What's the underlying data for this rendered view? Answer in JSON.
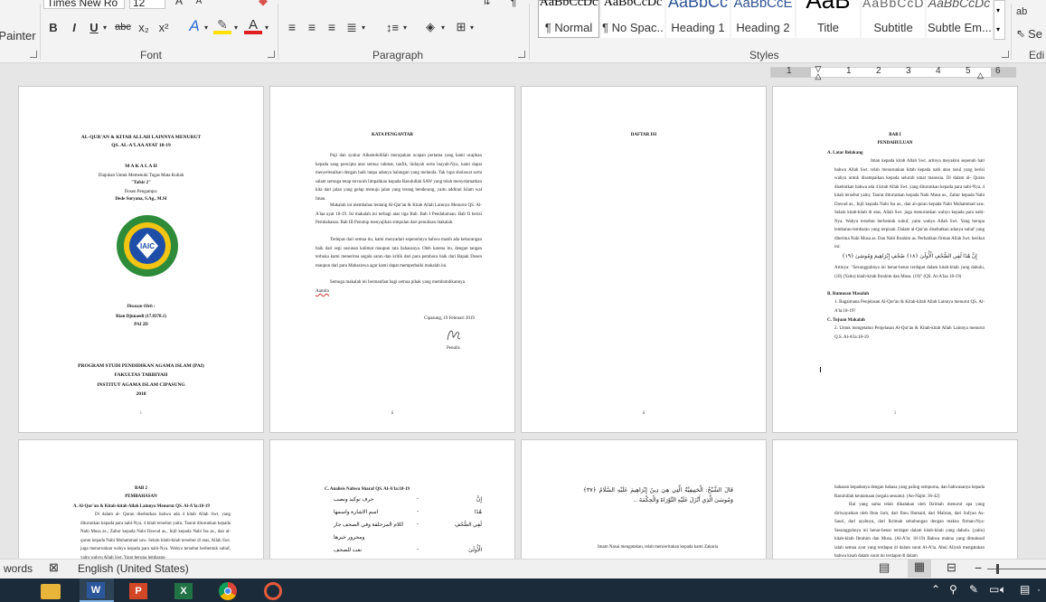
{
  "ribbon": {
    "clipboard": {
      "format_painter_label": "Painter"
    },
    "font": {
      "group_label": "Font",
      "font_name": "Times New Ro",
      "font_size": "12",
      "bold": "B",
      "italic": "I",
      "underline": "U",
      "strike": "abc",
      "subscript": "x₂",
      "superscript": "x²"
    },
    "paragraph": {
      "group_label": "Paragraph"
    },
    "styles": {
      "group_label": "Styles",
      "items": [
        {
          "preview": "AaBbCcDc",
          "name": "¶ Normal"
        },
        {
          "preview": "AaBbCcDc",
          "name": "¶ No Spac..."
        },
        {
          "preview": "AaBbCc",
          "name": "Heading 1"
        },
        {
          "preview": "AaBbCcE",
          "name": "Heading 2"
        },
        {
          "preview": "AaB",
          "name": "Title"
        },
        {
          "preview": "AaBbCcD",
          "name": "Subtitle"
        },
        {
          "preview": "AaBbCcDc",
          "name": "Subtle Em..."
        }
      ]
    },
    "editing": {
      "group_label": "Edi",
      "replace_label": "ac",
      "select_label": "Se"
    }
  },
  "ruler": {
    "numbers": [
      "1",
      "1",
      "2",
      "3",
      "4",
      "5",
      "6"
    ]
  },
  "pages": {
    "cover": {
      "title1": "AL-QUR'AN & KITAB ALLAH LAINNYA MENURUT",
      "title2": "QS. AL-A'LAA AYAT 18-19",
      "makalah": "M A K A L A H",
      "purpose": "Diajukan Untuk Memenuhi Tugas Mata Kuliah",
      "course": "\"Tafsir 2\"",
      "advisor_label": "Dosen Pengampu:",
      "advisor": "Dede Suryana, S.Ag., M.SI",
      "logo_text": "IAIC",
      "by_label": "Disusun Oleh :",
      "author": "Rian Djunaedi (17.0378.1)",
      "class": "PAI 2D",
      "prodi": "PROGRAM STUDI PENDIDIKAN AGAMA ISLAM (PAI)",
      "faculty": "FAKULTAS TARBIYAH",
      "institute": "INSTITUT AGAMA ISLAM CIPASUNG",
      "year": "2018",
      "page_number": "i"
    },
    "preface": {
      "heading": "KATA PENGANTAR",
      "p1": "Puji dan syukur Alhamdulillah merupakan ucapan pertama yang kami ucapkan kepada sang pencipta atas semua rahmat, taufik, hidayah serta inayah-Nya, kami dapat menyelesaikan dengan baik tanpa adanya halangan yang melanda. Tak lupa sholawat serta salam semoga tetap tercurah limpahkan kepada Rasulullah SAW yang telah menyelamatkan kita dari jalan yang gelap menuju jalan yang terang benderang, yaitu addinul Islam wal Iman.",
      "p2": "Makalah ini membahas tentang Al-Qur'an & Kitab Allah Lainnya Menurut QS. Al-A'laa ayat 18-19. Isi makalah ini terbagi atas tiga Bab. Bab I Pendahuluan. Bab II berisi Pembahasan. Bab III Penutup menyajikan simpulan dari penulisan makalah.",
      "p3": "Terlepas dari semua itu, kami menyadari sepenuhnya bahwa masih ada kekurangan baik dari segi susunan kalimat maupun tata bahasanya. Oleh karena itu, dengan tangan terbuka kami menerima segala saran dan kritik dari para pembaca baik dari Bapak Dosen maupun dari para Mahasiswa agar kami dapat memperbaiki makalah ini.",
      "p4": "Semoga makalah ini bermanfaat bagi semua pihak yang membutuhkannya.",
      "closing": "Aamiin",
      "place_date": "Cipasung, 19 Februari 2019",
      "signer": "Penulis",
      "page_number": "ii"
    },
    "toc": {
      "heading": "DAFTAR ISI",
      "page_number": "ii"
    },
    "bab1": {
      "heading1": "BAB I",
      "heading2": "PENDAHULUAN",
      "a_title": "A.  Latar Belakang",
      "a_text": "Iman kepada kitab Allah Swt. artinya meyakini sepenuh hati bahwa Allah Swt. telah menurunkan kitab kepada nabi atau rasul yang berisi wahyu untuk disampaikan kepada seluruh umat manusia. Di dalam al- Quran disebutkan bahwa ada 4 kitab Allah Swt. yang diturunkan kepada para nabi-Nya. 4 kitab tersebut yaitu; Taurat diturunkan kepada Nabi Musa as., Zabur kepada Nabi Dawud as., Injil kepada Nabi Isa as., dan al-quran kepada Nabi Muhammad saw. Selain kitab-kitab di atas, Allah Swt. juga menurunkan wahyu kepada para nabi-Nya. Wahyu tersebut berbentuk suhuf, yaitu wahyu Allah Swt. Yang berupa lembaran-lembaran yang terpisah. Dalam al-Qur'an disebutkan adanya suhuf yang diterima Nabi Musa as. Dan Nabi Ibrahim as. Perhatikan firman Allah Swt. berikut ini:",
      "arabic": "إِنَّ هَٰذَا لَفِي الصُّحُفِ الْأُولَىٰ ﴿١٨﴾ صُحُفِ إِبْرَاهِيمَ وَمُوسَىٰ ﴿١٩﴾",
      "translation": "Artinya: \"Sesungguhnya ini benar-benar terdapat dalam kitab-kitab yang dahulu, (18) (Yaitu) kitab-kitab Ibrahim dan Musa. (19)\" (QS. Al-A'laa 18-19)",
      "b_title": "B.  Rumusan Masalah",
      "b_text": "1.  Bagaimana Penjelasan Al-Qur'an & Kitab-kitab Allah Lainnya menurut QS. Al-A'la:18-19?",
      "c_title": "C.  Tujuan Makalah",
      "c_text": "2.  Untuk mengetahui Penjelasan Al-Qur'an & Kitab-kitab Allah Lainnya menurut Q.S. Al-A'la:18-19",
      "page_number": "1"
    },
    "bab2": {
      "heading1": "BAB 2",
      "heading2": "PEMBAHASAN",
      "a_title": "A.  Al-Qur'an & Kitab-kitab Allah Lainnya Menurut QS. Al-A'la:18-19",
      "a_text": "Di dalam al- Quran disebutkan bahwa ada 4 kitab Allah Swt. yang diturunkan kepada para nabi-Nya. 4 kitab tersebut yaitu; Taurat diturunkan kepada Nabi Musa as., Zabur kepada Nabi Dawud as., Injil kepada Nabi Isa as., dan al-quran kepada Nabi Muhammad saw. Selain kitab-kitab tersebut di atas, Allah Swt. juga menurunkan wahyu kepada para nabi-Nya. Wahyu tersebut berbentuk suhuf, yaitu wahyu Allah Swt. Yang berupa lembaran-"
    },
    "nahwu": {
      "title": "C.  Analisis Nahwu Sharaf QS. Al-A'la:18-19",
      "rows": [
        {
          "left": "حرف توكيد ونصب",
          "dash": "-",
          "right": "إِنَّ"
        },
        {
          "left": "اسم الاشارة واسمها",
          "dash": "-",
          "right": "هَٰذَا"
        },
        {
          "left": "اللام المزحلقة وفي الصحف جار",
          "dash": "-",
          "right": "لَفِي الصُّحُفِ"
        },
        {
          "left": "ومجرور خبرها",
          "dash": "",
          "right": ""
        },
        {
          "left": "نعت للصحف",
          "dash": "-",
          "right": "الْأُولَىٰ"
        }
      ]
    },
    "tafsir": {
      "arabic": "قَالَ الشَّيْخُ: الْحَنِيفِيَّةُ الَّتِي هِيَ دِينُ إِبْرَاهِيمَ عَلَيْهِ السَّلَامُ ﴿٣٧﴾ وَمُوسَىٰ الَّذِي أَنْزَلَ عَلَيْهِ التَّوْرَاةَ وَالْحِكْمَةَ ...",
      "text": "Imam Nasai mengatakan, telah menceritakan kepada kami Zakaria"
    },
    "last": {
      "text1": "bahasan kepadanya dengan bahasa yang paling sempurna, dan bahwasanya kepada Rasulullah keutamaan (segala sesuatu). (An-Najm: 36-42)",
      "text2": "Hal yang sama telah dikatakan oleh Ikrimah menurut apa yang diriwayatkan oleh Ibnu Jarir, dari Ibnu Humaid, dari Mahran, dari Sufyan As-Sauri, dari ayahnya, dari Ikrimah sehubungan dengan makna firman-Nya: Sesungguhnya ini benar-benar terdapat dalam kitab-kitab yang dahulu. (yaitu) kitab-kitab Ibrahim dan Musa. (Al-A'la: 18-19) Bahwa makna yang dimaksud ialah semua ayat yang terdapat di dalam surat Al-A'la. Abul Aliyah mengatakan bahwa kisah dalam surat ini terdapat di dalam"
    }
  },
  "status": {
    "words_label": "words",
    "language": "English (United States)"
  },
  "taskbar": {
    "apps": [
      "word-app",
      "powerpoint-app",
      "excel-app",
      "chrome-app",
      "other-app"
    ]
  },
  "colors": {
    "ribbon_bg": "#f3f3f3",
    "canvas_bg": "#e6e6e6",
    "taskbar_bg": "#1c2b3a",
    "word_blue": "#2b579a",
    "ppt_red": "#d24726",
    "excel_green": "#217346",
    "squiggle_red": "#d33333",
    "logo_green": "#2e8b3a",
    "logo_blue": "#1e4ea8",
    "logo_yellow": "#f2c413"
  }
}
